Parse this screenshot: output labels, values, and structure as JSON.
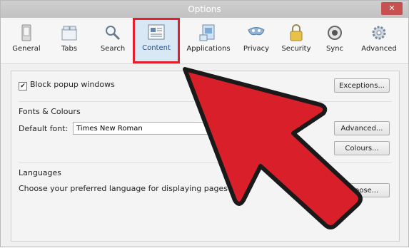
{
  "window": {
    "title": "Options",
    "close_glyph": "✕"
  },
  "toolbar": {
    "items": [
      {
        "label": "General",
        "icon": "general-icon"
      },
      {
        "label": "Tabs",
        "icon": "tabs-icon"
      },
      {
        "label": "Search",
        "icon": "search-icon"
      },
      {
        "label": "Content",
        "icon": "content-icon",
        "selected": true
      },
      {
        "label": "Applications",
        "icon": "applications-icon"
      },
      {
        "label": "Privacy",
        "icon": "privacy-icon"
      },
      {
        "label": "Security",
        "icon": "security-icon"
      },
      {
        "label": "Sync",
        "icon": "sync-icon"
      },
      {
        "label": "Advanced",
        "icon": "advanced-icon"
      }
    ]
  },
  "content": {
    "popup_checkbox_label": "Block popup windows",
    "popup_checked": true,
    "exceptions_button": "Exceptions...",
    "fonts_heading": "Fonts & Colours",
    "default_font_label": "Default font:",
    "default_font_value": "Times New Roman",
    "advanced_button": "Advanced...",
    "colours_button": "Colours...",
    "languages_heading": "Languages",
    "languages_text": "Choose your preferred language for displaying pages",
    "choose_button": "Choose..."
  },
  "colors": {
    "highlight": "#e0202b",
    "arrow": "#d9202a"
  }
}
